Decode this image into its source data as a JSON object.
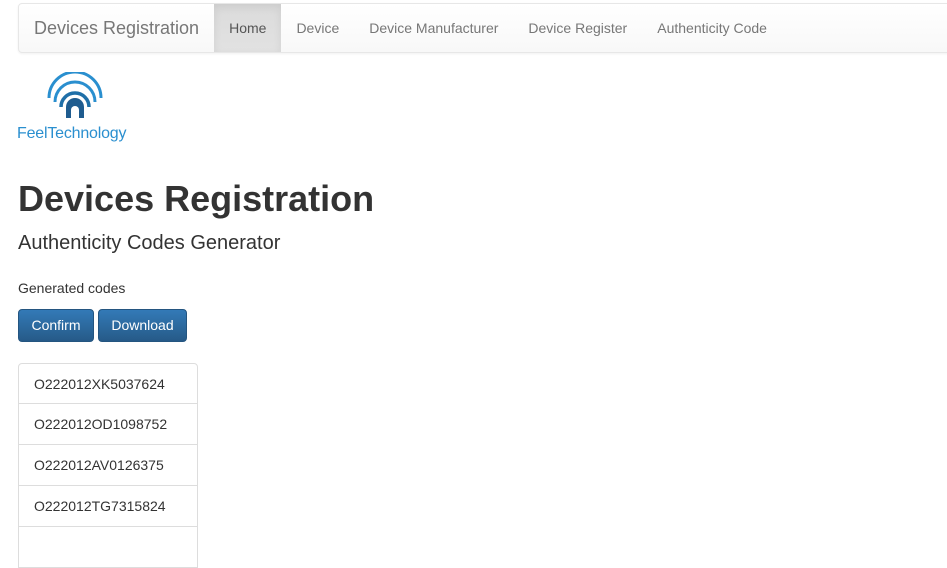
{
  "navbar": {
    "brand": "Devices Registration",
    "items": [
      {
        "label": "Home",
        "active": true
      },
      {
        "label": "Device",
        "active": false
      },
      {
        "label": "Device Manufacturer",
        "active": false
      },
      {
        "label": "Device Register",
        "active": false
      },
      {
        "label": "Authenticity Code",
        "active": false
      }
    ]
  },
  "logo": {
    "text": "FeelTechnology",
    "icon": "signal-arch-icon",
    "color": "#2a8fcf"
  },
  "page": {
    "title": "Devices Registration",
    "subtitle": "Authenticity Codes Generator",
    "section_label": "Generated codes"
  },
  "actions": {
    "confirm_label": "Confirm",
    "download_label": "Download",
    "primary_color": "#337ab7"
  },
  "codes": [
    "O222012XK5037624",
    "O222012OD1098752",
    "O222012AV0126375",
    "O222012TG7315824"
  ]
}
